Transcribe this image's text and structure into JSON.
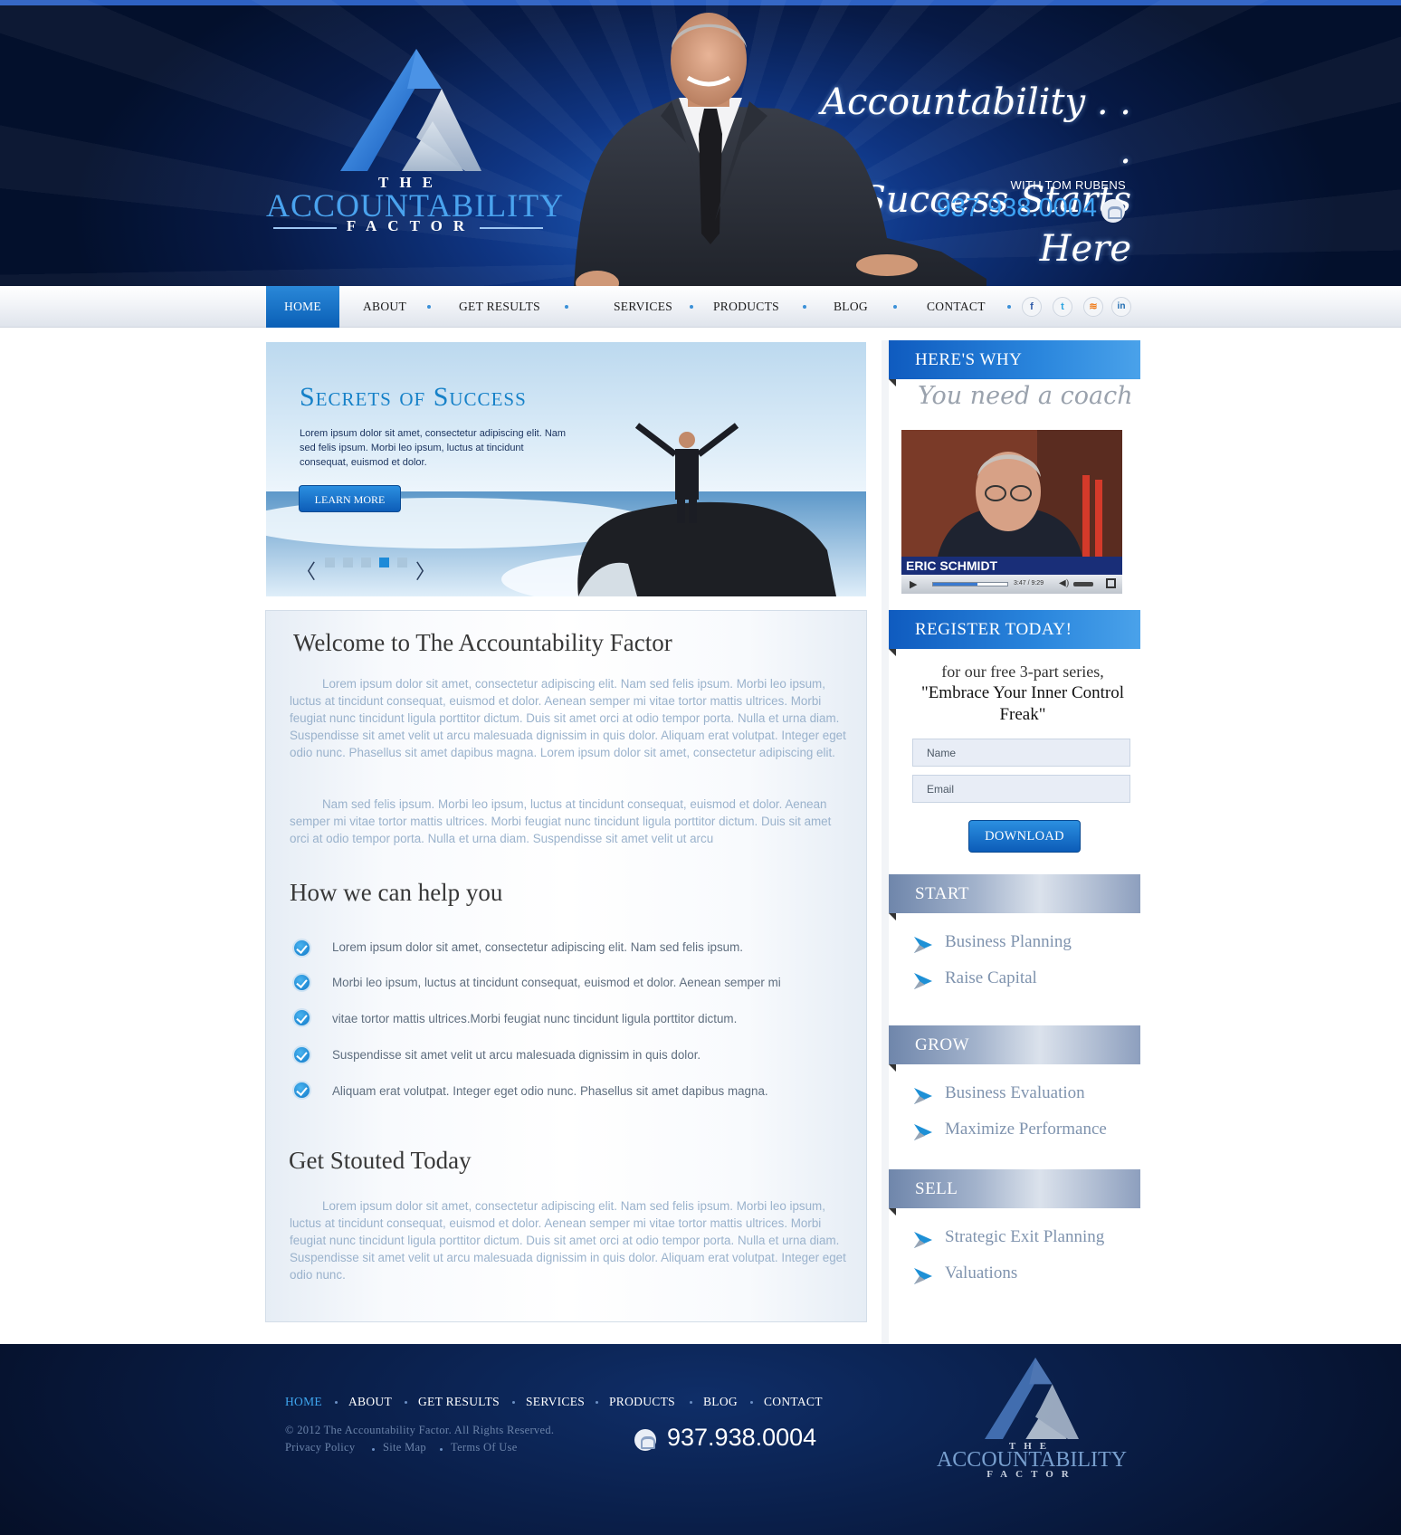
{
  "header": {
    "logo": {
      "the": "THE",
      "accountability": "ACCOUNTABILITY",
      "factor": "FACTOR"
    },
    "tagline_line1": "Accountability . . .",
    "tagline_line2": "Success Starts Here",
    "with_label": "WITH TOM RUBENS",
    "phone": "937.938.0004"
  },
  "nav": {
    "items": [
      "HOME",
      "ABOUT",
      "GET RESULTS",
      "SERVICES",
      "PRODUCTS",
      "BLOG",
      "CONTACT"
    ],
    "active": "HOME",
    "social": [
      "f",
      "t",
      "rss",
      "in"
    ]
  },
  "slider": {
    "title": "Secrets of Success",
    "text": "Lorem ipsum dolor sit amet, consectetur adipiscing elit. Nam sed felis ipsum. Morbi leo ipsum, luctus at tincidunt consequat, euismod et dolor.",
    "button": "LEARN MORE",
    "slides": 5,
    "active_slide": 4
  },
  "main": {
    "welcome_title": "Welcome to The Accountability Factor",
    "welcome_p1": "Lorem ipsum dolor sit amet, consectetur adipiscing elit. Nam sed felis ipsum. Morbi leo ipsum, luctus at tincidunt consequat, euismod et dolor. Aenean semper mi vitae tortor mattis ultrices. Morbi feugiat nunc tincidunt ligula porttitor dictum. Duis sit amet orci at odio tempor porta. Nulla et urna diam. Suspendisse sit amet velit ut arcu malesuada dignissim in quis dolor. Aliquam erat volutpat. Integer eget odio nunc. Phasellus sit amet dapibus magna. Lorem ipsum dolor sit amet, consectetur adipiscing elit.",
    "welcome_p2": "Nam sed felis ipsum. Morbi leo ipsum, luctus at tincidunt consequat, euismod et dolor. Aenean semper mi vitae tortor mattis ultrices. Morbi feugiat nunc tincidunt ligula porttitor dictum. Duis sit amet orci at odio tempor porta. Nulla et urna diam. Suspendisse sit amet velit ut arcu",
    "help_title": "How we can help you",
    "help_items": [
      "Lorem ipsum dolor sit amet, consectetur adipiscing elit. Nam sed felis ipsum.",
      "Morbi leo ipsum, luctus at tincidunt consequat, euismod et dolor. Aenean semper mi",
      "vitae tortor mattis ultrices.Morbi feugiat nunc tincidunt ligula porttitor dictum.",
      "Suspendisse sit amet velit ut arcu malesuada dignissim in quis dolor.",
      "Aliquam erat volutpat. Integer eget odio nunc. Phasellus sit amet dapibus magna."
    ],
    "stouted_title": "Get Stouted Today",
    "stouted_p": "Lorem ipsum dolor sit amet, consectetur adipiscing elit. Nam sed felis ipsum. Morbi leo ipsum, luctus at tincidunt consequat, euismod et dolor. Aenean semper mi vitae tortor mattis ultrices. Morbi feugiat nunc tincidunt ligula porttitor dictum. Duis sit amet orci at odio tempor porta. Nulla et urna diam. Suspendisse sit amet velit ut arcu malesuada dignissim in quis dolor. Aliquam erat volutpat. Integer eget odio nunc."
  },
  "sidebar": {
    "why_title": "HERE'S WHY",
    "why_sub": "You need a coach",
    "video": {
      "name": "ERIC SCHMIDT",
      "time": "3:47 / 9:29"
    },
    "register_title": "REGISTER TODAY!",
    "register_line1": "for our free 3-part series,",
    "register_line2": "\"Embrace Your Inner Control Freak\"",
    "name_placeholder": "Name",
    "email_placeholder": "Email",
    "download": "DOWNLOAD",
    "start_title": "START",
    "start_items": [
      "Business Planning",
      "Raise Capital"
    ],
    "grow_title": "GROW",
    "grow_items": [
      "Business Evaluation",
      "Maximize Performance"
    ],
    "sell_title": "SELL",
    "sell_items": [
      "Strategic Exit Planning",
      "Valuations"
    ]
  },
  "footer": {
    "nav": [
      "HOME",
      "ABOUT",
      "GET RESULTS",
      "SERVICES",
      "PRODUCTS",
      "BLOG",
      "CONTACT"
    ],
    "copyright": "© 2012 The Accountability Factor. All Rights Reserved.",
    "links": [
      "Privacy Policy",
      "Site Map",
      "Terms Of Use"
    ],
    "phone": "937.938.0004",
    "logo": {
      "the": "THE",
      "accountability": "ACCOUNTABILITY",
      "factor": "FACTOR"
    }
  },
  "colors": {
    "accent": "#1681c8",
    "navy": "#071a47",
    "muted_text": "#9ab2cc"
  }
}
